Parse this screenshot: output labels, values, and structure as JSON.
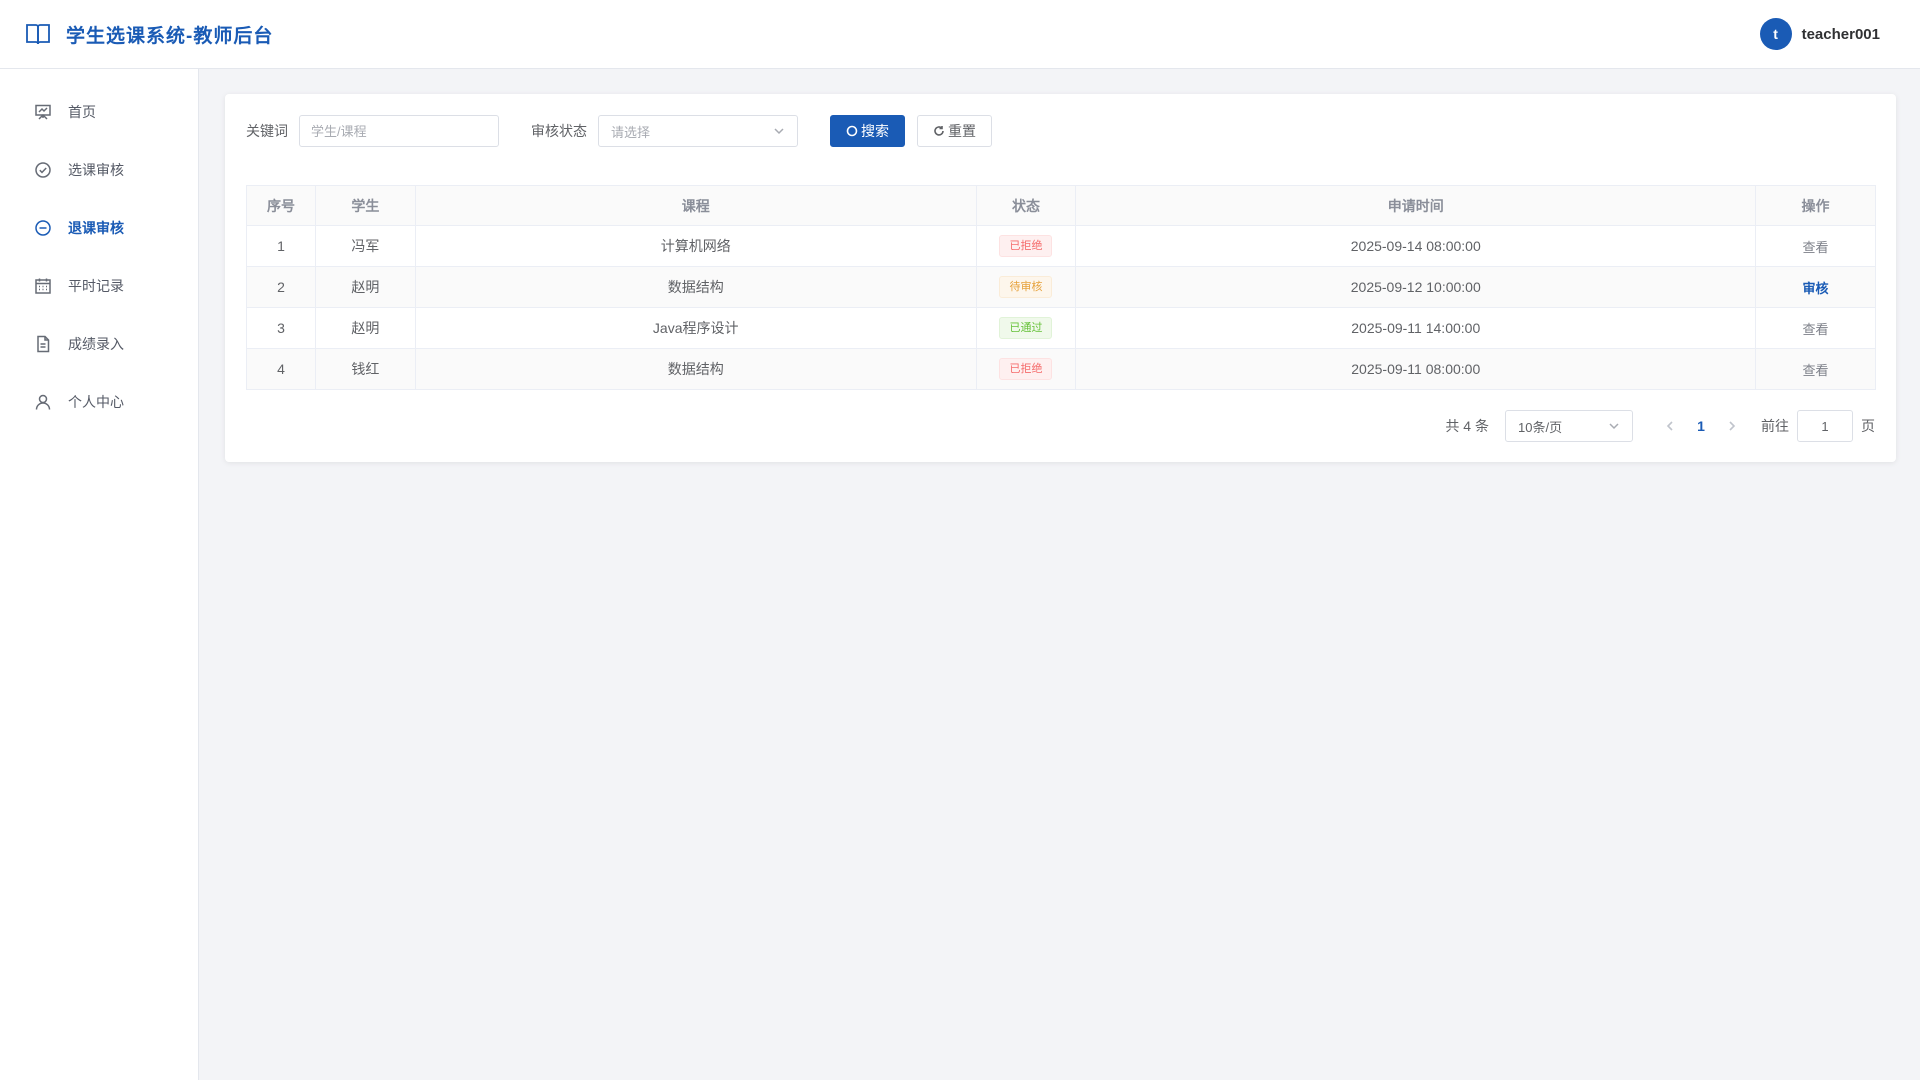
{
  "header": {
    "title": "学生选课系统-教师后台",
    "user": {
      "avatar_letter": "t",
      "name": "teacher001"
    }
  },
  "sidebar": {
    "items": [
      {
        "label": "首页",
        "icon": "dashboard-icon"
      },
      {
        "label": "选课审核",
        "icon": "check-circle-icon"
      },
      {
        "label": "退课审核",
        "icon": "minus-circle-icon",
        "active": true
      },
      {
        "label": "平时记录",
        "icon": "calendar-icon"
      },
      {
        "label": "成绩录入",
        "icon": "document-icon"
      },
      {
        "label": "个人中心",
        "icon": "user-icon"
      }
    ]
  },
  "filters": {
    "keyword_label": "关键词",
    "keyword_placeholder": "学生/课程",
    "keyword_value": "",
    "status_label": "审核状态",
    "status_placeholder": "请选择",
    "search_label": "搜索",
    "reset_label": "重置"
  },
  "table": {
    "columns": [
      "序号",
      "学生",
      "课程",
      "状态",
      "申请时间",
      "操作"
    ],
    "rows": [
      {
        "index": "1",
        "student": "冯军",
        "course": "计算机网络",
        "status": "已拒绝",
        "status_type": "danger",
        "time": "2025-09-14 08:00:00",
        "action": "查看"
      },
      {
        "index": "2",
        "student": "赵明",
        "course": "数据结构",
        "status": "待审核",
        "status_type": "warning",
        "time": "2025-09-12 10:00:00",
        "action": "审核"
      },
      {
        "index": "3",
        "student": "赵明",
        "course": "Java程序设计",
        "status": "已通过",
        "status_type": "success",
        "time": "2025-09-11 14:00:00",
        "action": "查看"
      },
      {
        "index": "4",
        "student": "钱红",
        "course": "数据结构",
        "status": "已拒绝",
        "status_type": "danger",
        "time": "2025-09-11 08:00:00",
        "action": "查看"
      }
    ]
  },
  "pagination": {
    "total_text": "共 4 条",
    "page_size": "10条/页",
    "current_page": "1",
    "goto_label": "前往",
    "goto_value": "1",
    "page_unit": "页"
  },
  "colors": {
    "primary": "#1a5bb5",
    "danger": "#f56c6c",
    "warning": "#e6a23c",
    "success": "#67c23a"
  }
}
